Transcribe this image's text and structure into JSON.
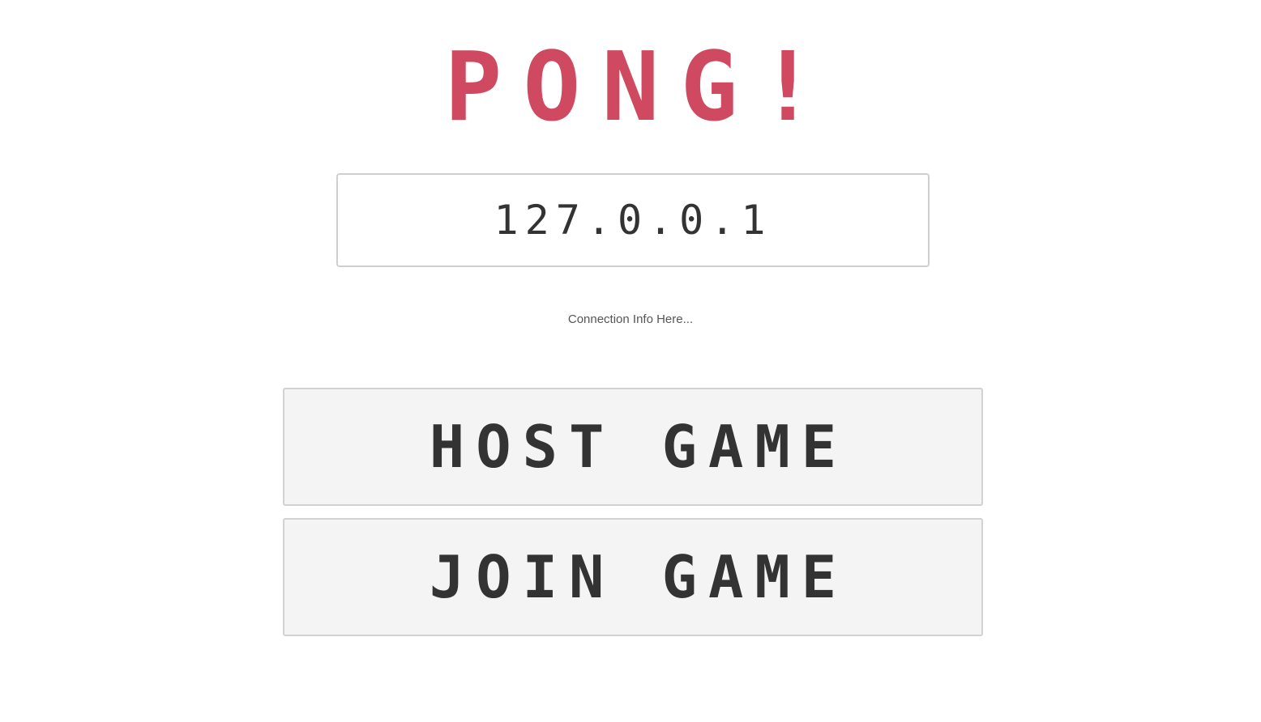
{
  "title": "PONG!",
  "ip_input": {
    "value": "127.0.0.1"
  },
  "connection_info": "Connection Info Here...",
  "buttons": {
    "host": "HOST GAME",
    "join": "JOIN GAME"
  },
  "colors": {
    "title": "#cf4a60",
    "button_text": "#333333",
    "button_bg": "#f4f4f4",
    "page_bg": "#ffffff"
  }
}
